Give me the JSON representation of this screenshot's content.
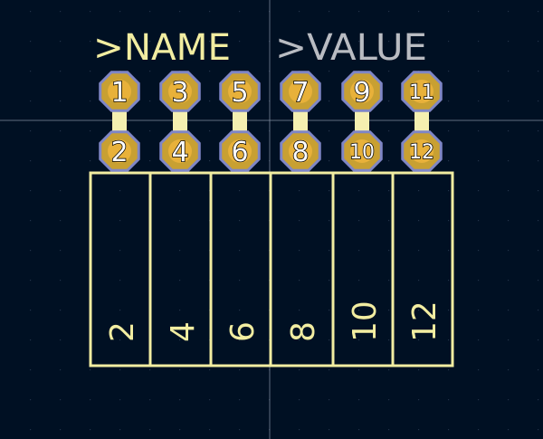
{
  "footprint": {
    "name_text": ">NAME",
    "value_text": ">VALUE",
    "pads": [
      {
        "number": "1",
        "row": "top"
      },
      {
        "number": "3",
        "row": "top"
      },
      {
        "number": "5",
        "row": "top"
      },
      {
        "number": "7",
        "row": "top"
      },
      {
        "number": "9",
        "row": "top"
      },
      {
        "number": "11",
        "row": "top"
      },
      {
        "number": "2",
        "row": "bottom"
      },
      {
        "number": "4",
        "row": "bottom"
      },
      {
        "number": "6",
        "row": "bottom"
      },
      {
        "number": "8",
        "row": "bottom"
      },
      {
        "number": "10",
        "row": "bottom"
      },
      {
        "number": "12",
        "row": "bottom"
      }
    ],
    "body_labels": [
      "2",
      "4",
      "6",
      "8",
      "10",
      "12"
    ]
  },
  "colors": {
    "background": "#001023",
    "grid_dot": "#23344a",
    "crosshair": "#8a94a6",
    "silkscreen": "#f2eda1",
    "name_text": "#f2eda1",
    "value_text": "#b9bcc2",
    "pad_fill": "#c8a032",
    "pad_edge": "#7f86c6",
    "pad_hole": "#e8b13a",
    "pad_number": "#ffffff",
    "trace": "#f5efb0"
  }
}
